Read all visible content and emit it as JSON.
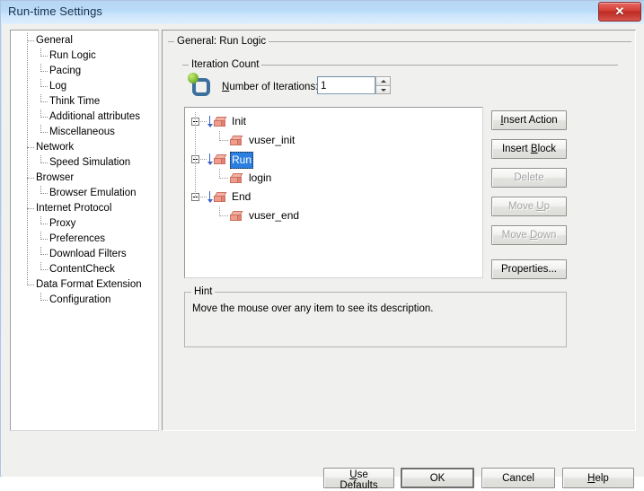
{
  "window": {
    "title": "Run-time Settings",
    "close_label": "✕"
  },
  "sidebar": {
    "items": [
      {
        "label": "General",
        "level": 0
      },
      {
        "label": "Run Logic",
        "level": 1
      },
      {
        "label": "Pacing",
        "level": 1
      },
      {
        "label": "Log",
        "level": 1
      },
      {
        "label": "Think Time",
        "level": 1
      },
      {
        "label": "Additional attributes",
        "level": 1
      },
      {
        "label": "Miscellaneous",
        "level": 1
      },
      {
        "label": "Network",
        "level": 0
      },
      {
        "label": "Speed Simulation",
        "level": 1
      },
      {
        "label": "Browser",
        "level": 0
      },
      {
        "label": "Browser Emulation",
        "level": 1
      },
      {
        "label": "Internet Protocol",
        "level": 0
      },
      {
        "label": "Proxy",
        "level": 1
      },
      {
        "label": "Preferences",
        "level": 1
      },
      {
        "label": "Download Filters",
        "level": 1
      },
      {
        "label": "ContentCheck",
        "level": 1
      },
      {
        "label": "Data Format Extension",
        "level": 0
      },
      {
        "label": "Configuration",
        "level": 1
      }
    ]
  },
  "main": {
    "group_label": "General: Run Logic",
    "iteration": {
      "group_label": "Iteration Count",
      "field_label_prefix": "",
      "field_label_accel": "N",
      "field_label_rest": "umber of Iterations:",
      "value": "1",
      "icon": "loop-icon"
    },
    "action_tree": [
      {
        "label": "Init",
        "level": 0,
        "selected": false,
        "icon": "block-icon"
      },
      {
        "label": "vuser_init",
        "level": 1,
        "selected": false,
        "icon": "block-icon"
      },
      {
        "label": "Run",
        "level": 0,
        "selected": true,
        "icon": "block-icon"
      },
      {
        "label": "login",
        "level": 1,
        "selected": false,
        "icon": "block-icon"
      },
      {
        "label": "End",
        "level": 0,
        "selected": false,
        "icon": "block-icon"
      },
      {
        "label": "vuser_end",
        "level": 1,
        "selected": false,
        "icon": "block-icon"
      }
    ],
    "side_buttons": [
      {
        "id": "insert-action",
        "accel": "I",
        "pre": "",
        "post": "nsert Action",
        "enabled": true
      },
      {
        "id": "insert-block",
        "accel": "B",
        "pre": "Insert ",
        "post": "lock",
        "enabled": true
      },
      {
        "id": "delete",
        "accel": "",
        "pre": "Delete",
        "post": "",
        "enabled": false
      },
      {
        "id": "move-up",
        "accel": "U",
        "pre": "Move ",
        "post": "p",
        "enabled": false
      },
      {
        "id": "move-down",
        "accel": "D",
        "pre": "Move ",
        "post": "own",
        "enabled": false
      },
      {
        "id": "properties",
        "accel": "",
        "pre": "Properties...",
        "post": "",
        "enabled": true
      }
    ],
    "hint": {
      "group_label": "Hint",
      "text": "Move the mouse over any item to see its description."
    }
  },
  "footer": {
    "buttons": [
      {
        "id": "use-defaults",
        "accel": "U",
        "pre": "",
        "post": "se Defaults"
      },
      {
        "id": "ok",
        "accel": "",
        "pre": "OK",
        "post": ""
      },
      {
        "id": "cancel",
        "accel": "",
        "pre": "Cancel",
        "post": ""
      },
      {
        "id": "help",
        "accel": "H",
        "pre": "",
        "post": "elp"
      }
    ]
  },
  "colors": {
    "selection_blue": "#2a7fe0",
    "close_red": "#d33c34",
    "loop_blue": "#3d6f9e",
    "loop_green": "#8cc63f",
    "block_pink": "#ef9c8c"
  }
}
